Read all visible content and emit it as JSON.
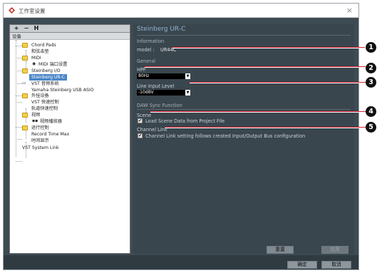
{
  "window": {
    "title": "工作室设置",
    "close": "×"
  },
  "toolbar": {
    "add": "+",
    "remove": "−",
    "reset": "H"
  },
  "tree": {
    "header": "设备",
    "nodes": [
      "Chord Pads",
      "和弦击垫",
      "MIDI",
      "MIDI 端口设置",
      "Steinberg I/O",
      "Steinberg UR-C",
      "VST 音频系统",
      "Yamaha Steinberg USB ASIO",
      "外挂设备",
      "VST 快速控制",
      "轨道快速控制",
      "视频",
      "视频播放器",
      "运行控制",
      "Record Time Max",
      "时间显示",
      "VST System Link"
    ]
  },
  "panel": {
    "device_title": "Steinberg UR-C",
    "information_label": "Information",
    "model_label": "model :",
    "model_value": "UR44C",
    "general_label": "General",
    "hpf_label": "HPF",
    "hpf_value": "80Hz",
    "line_input_label": "Line Input Level",
    "line_input_value": "-10dBV",
    "daw_label": "DAW Sync Function",
    "scene_label": "Scene",
    "scene_checkbox": "Load Scene Data from Project File",
    "channel_link_label": "Channel Link",
    "channel_link_checkbox": "Channel Link setting follows created Input/Output Bus configuration",
    "check": "✔"
  },
  "buttons": {
    "reset": "重置",
    "apply": "应用",
    "ok": "确定",
    "cancel": "取消"
  },
  "callouts": [
    "1",
    "2",
    "3",
    "4",
    "5"
  ],
  "colors": {
    "selected": "#4a86c8",
    "panel_bg": "#3a464e",
    "title_blue": "#8fb3cf"
  }
}
